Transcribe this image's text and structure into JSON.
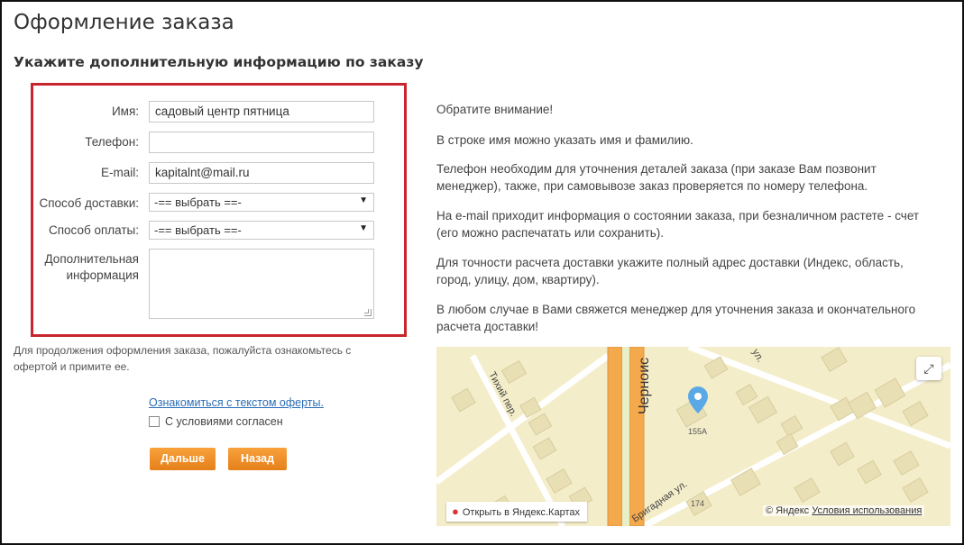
{
  "page": {
    "title": "Оформление заказа",
    "section_title": "Укажите дополнительную информацию по заказу"
  },
  "form": {
    "name_label": "Имя:",
    "name_value": "садовый центр пятница",
    "phone_label": "Телефон:",
    "phone_value": "",
    "email_label": "E-mail:",
    "email_value": "kapitalnt@mail.ru",
    "delivery_label": "Способ доставки:",
    "delivery_value": "-== выбрать ==-",
    "payment_label": "Способ оплаты:",
    "payment_value": "-== выбрать ==-",
    "extra_label_line1": "Дополнительная",
    "extra_label_line2": "информация",
    "extra_value": ""
  },
  "offer": {
    "notice_line1": "Для продолжения оформления заказа, пожалуйста ознакомьтесь с",
    "notice_line2": "офертой и примите ее.",
    "link_text": "Ознакомиться с текстом оферты.",
    "agree_text": "С условиями согласен",
    "agree_checked": false
  },
  "buttons": {
    "next": "Дальше",
    "back": "Назад"
  },
  "info": {
    "attention": "Обратите внимание!",
    "p1": "В строке имя можно указать имя и фамилию.",
    "p2_line1": "Телефон необходим для уточнения деталей заказа (при заказе Вам позвонит",
    "p2_line2": "менеджер), также, при самовывозе заказ проверяется по номеру телефона.",
    "p3_line1": "На e-mail приходит информация о состоянии заказа, при безналичном растете - счет",
    "p3_line2": "(его можно распечатать или сохранить).",
    "p4_line1": "Для точности расчета доставки укажите полный адрес доставки (Индекс, область,",
    "p4_line2": "город, улицу, дом, квартиру).",
    "p5_line1": "В любом случае в Вами свяжется менеджер для уточнения заказа и окончательного",
    "p5_line2": "расчета доставки!"
  },
  "map": {
    "street_tikhiy": "Тихий пер.",
    "street_chernois": "Черноис",
    "street_brigadnaya": "Бригадная ул.",
    "street_ul": "ул.",
    "building_155a": "155А",
    "building_174": "174",
    "open_link": "Открыть в Яндекс.Картах",
    "copyright": "© Яндекс",
    "terms": "Условия использования",
    "expand_icon": "expand-icon",
    "pin_icon": "map-pin-icon"
  },
  "colors": {
    "highlight_border": "#c9252c",
    "button_orange": "#f0901f",
    "link_blue": "#2a6db5",
    "map_bg": "#f4edc9",
    "map_road": "#f3a94c",
    "map_building": "#e6ddb8"
  }
}
